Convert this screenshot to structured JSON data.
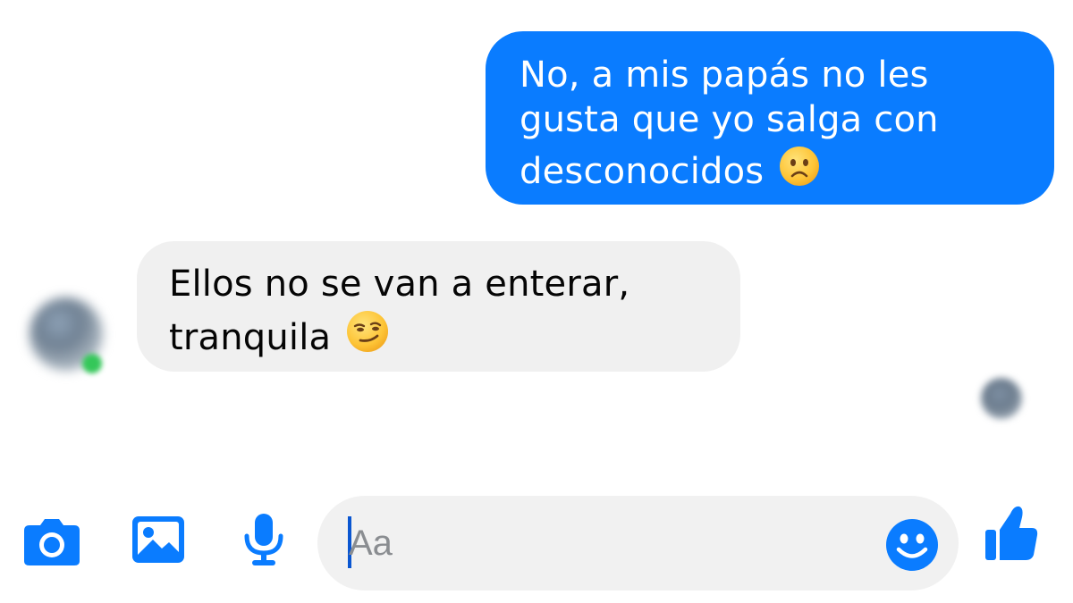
{
  "messages": [
    {
      "direction": "outgoing",
      "lines": [
        "No, a mis papás no les",
        "gusta que yo salga con",
        "desconocidos"
      ],
      "emoji": "worried-face",
      "bubble_color": "#0a7cff",
      "text_color": "#ffffff"
    },
    {
      "direction": "incoming",
      "lines": [
        "Ellos no se van a enterar,",
        "tranquila"
      ],
      "emoji": "smirking-face",
      "bubble_color": "#f0f0f0",
      "text_color": "#050505"
    }
  ],
  "contact": {
    "online": true,
    "online_color": "#34c759"
  },
  "composer": {
    "placeholder": "Aa",
    "icons": [
      "camera-icon",
      "gallery-icon",
      "microphone-icon",
      "emoji-icon",
      "thumbs-up-icon"
    ],
    "accent_color": "#0a7cff"
  }
}
